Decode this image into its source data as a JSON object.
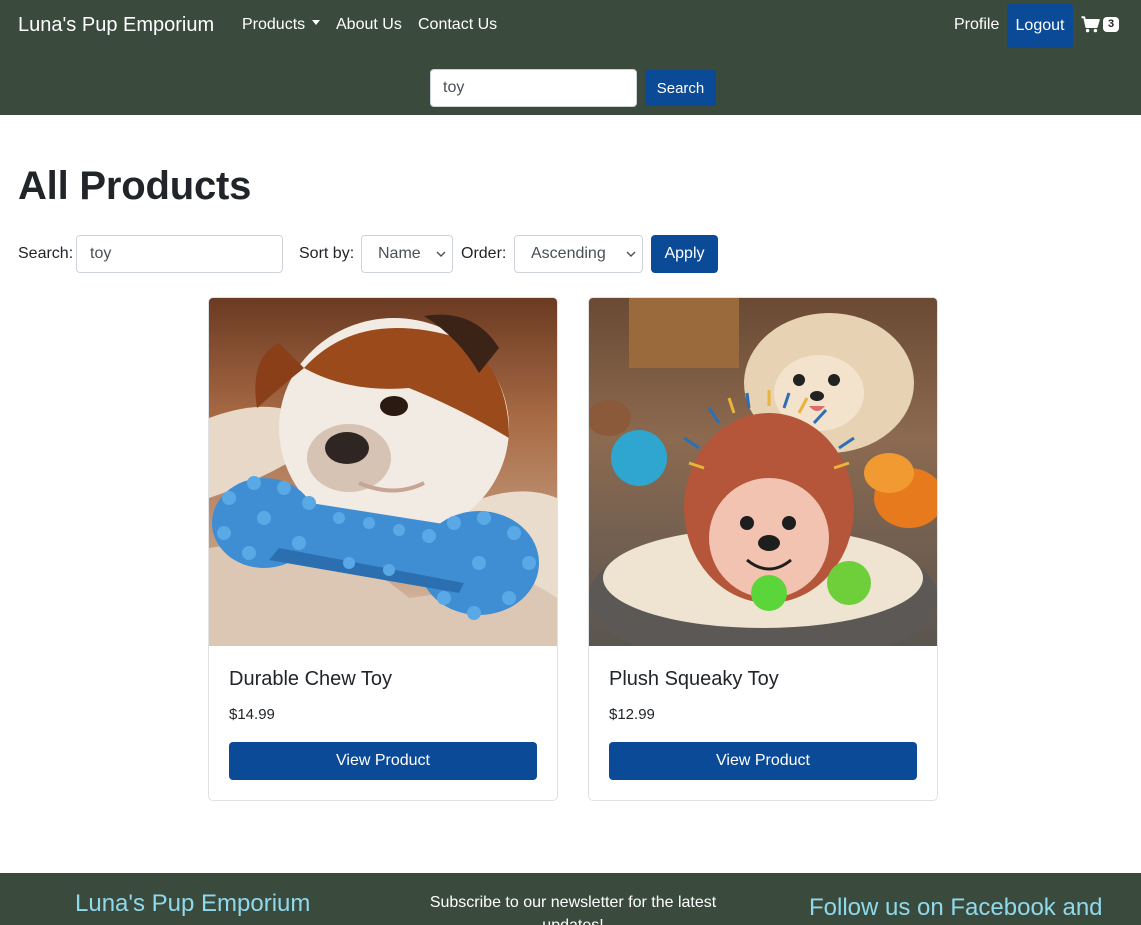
{
  "navbar": {
    "brand": "Luna's Pup Emporium",
    "links": {
      "products": "Products",
      "about": "About Us",
      "contact": "Contact Us",
      "profile": "Profile",
      "logout": "Logout"
    },
    "cart_count": "3",
    "search_value": "toy",
    "search_button": "Search"
  },
  "main": {
    "title": "All Products",
    "filters": {
      "search_label": "Search:",
      "search_value": "toy",
      "sort_label": "Sort by:",
      "sort_value": "Name",
      "order_label": "Order:",
      "order_value": "Ascending",
      "apply_button": "Apply"
    },
    "products": [
      {
        "name": "Durable Chew Toy",
        "price": "$14.99",
        "button": "View Product"
      },
      {
        "name": "Plush Squeaky Toy",
        "price": "$12.99",
        "button": "View Product"
      }
    ]
  },
  "footer": {
    "brand": "Luna's Pup Emporium",
    "newsletter": "Subscribe to our newsletter for the latest updates!",
    "follow": "Follow us on Facebook and"
  },
  "colors": {
    "navbar_bg": "#3a4a3d",
    "primary": "#0b4a96",
    "footer_accent": "#8fd9ec"
  }
}
